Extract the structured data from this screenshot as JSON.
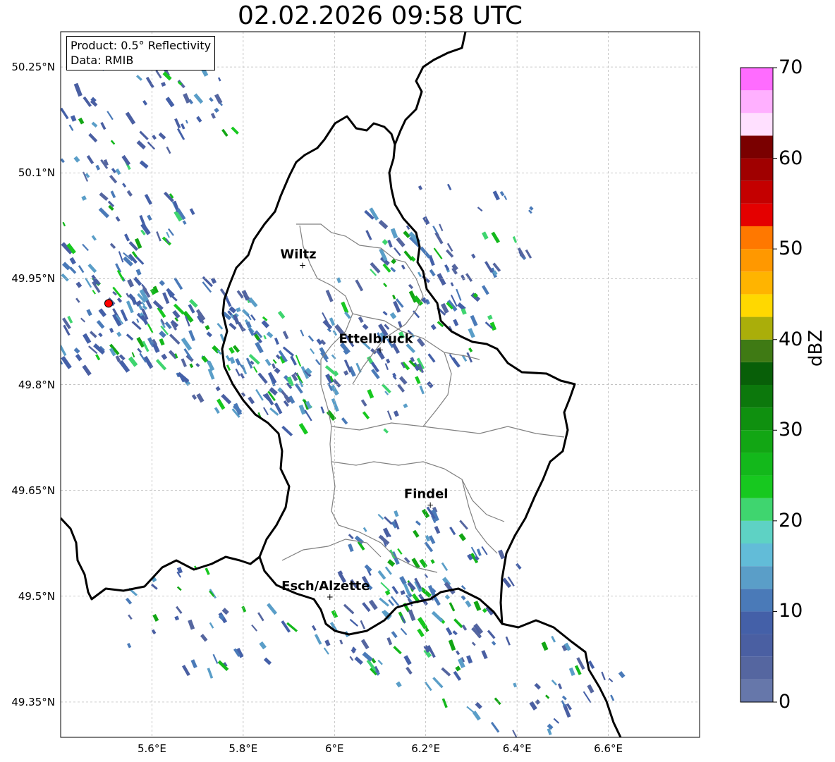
{
  "title": "02.02.2026 09:58 UTC",
  "info_box": {
    "product": "Product: 0.5° Reflectivity",
    "data": "Data: RMIB"
  },
  "map": {
    "lon_range": [
      5.4,
      6.8
    ],
    "lat_range": [
      49.3,
      50.3
    ],
    "lat_ticks": [
      {
        "value": 50.25,
        "label": "50.25°N"
      },
      {
        "value": 50.1,
        "label": "50.1°N"
      },
      {
        "value": 49.95,
        "label": "49.95°N"
      },
      {
        "value": 49.8,
        "label": "49.8°N"
      },
      {
        "value": 49.65,
        "label": "49.65°N"
      },
      {
        "value": 49.5,
        "label": "49.5°N"
      },
      {
        "value": 49.35,
        "label": "49.35°N"
      }
    ],
    "lon_ticks": [
      {
        "value": 5.6,
        "label": "5.6°E"
      },
      {
        "value": 5.8,
        "label": "5.8°E"
      },
      {
        "value": 6.0,
        "label": "6°E"
      },
      {
        "value": 6.2,
        "label": "6.2°E"
      },
      {
        "value": 6.4,
        "label": "6.4°E"
      },
      {
        "value": 6.6,
        "label": "6.6°E"
      }
    ],
    "cities": [
      {
        "name": "Wiltz",
        "lon": 5.93,
        "lat": 49.97
      },
      {
        "name": "Ettelbruck",
        "lon": 6.1,
        "lat": 49.85
      },
      {
        "name": "Findel",
        "lon": 6.21,
        "lat": 49.63
      },
      {
        "name": "Esch/Alzette",
        "lon": 5.99,
        "lat": 49.5
      }
    ],
    "radar_site": {
      "lon": 5.505,
      "lat": 49.915,
      "color": "#ff0000"
    },
    "colors": {
      "grid": "#b0b0b0",
      "national_border": "#000000",
      "canton_border": "#808080",
      "frame": "#000000"
    },
    "precip_cores": [
      {
        "lon": 5.45,
        "lat": 49.9,
        "intensity": 0.35
      },
      {
        "lon": 5.65,
        "lat": 49.88,
        "intensity": 0.4
      },
      {
        "lon": 5.85,
        "lat": 49.83,
        "intensity": 0.3
      },
      {
        "lon": 6.0,
        "lat": 49.8,
        "intensity": 0.25
      },
      {
        "lon": 6.15,
        "lat": 49.9,
        "intensity": 0.3
      },
      {
        "lon": 6.25,
        "lat": 50.02,
        "intensity": 0.2
      },
      {
        "lon": 5.6,
        "lat": 50.2,
        "intensity": 0.2
      },
      {
        "lon": 6.2,
        "lat": 49.55,
        "intensity": 0.3
      },
      {
        "lon": 6.15,
        "lat": 49.45,
        "intensity": 0.3
      },
      {
        "lon": 6.42,
        "lat": 49.38,
        "intensity": 0.15
      },
      {
        "lon": 5.72,
        "lat": 49.47,
        "intensity": 0.15
      },
      {
        "lon": 5.48,
        "lat": 50.05,
        "intensity": 0.25
      }
    ]
  },
  "colorbar": {
    "label": "dBZ",
    "min": 0,
    "max": 70,
    "step": 2.5,
    "ticks": [
      {
        "value": 0,
        "label": "0"
      },
      {
        "value": 10,
        "label": "10"
      },
      {
        "value": 20,
        "label": "20"
      },
      {
        "value": 30,
        "label": "30"
      },
      {
        "value": 40,
        "label": "40"
      },
      {
        "value": 50,
        "label": "50"
      },
      {
        "value": 60,
        "label": "60"
      },
      {
        "value": 70,
        "label": "70"
      }
    ],
    "colors": [
      "#6677aa",
      "#5566a0",
      "#4a5fa2",
      "#4460a8",
      "#4a7ab8",
      "#5a9ec8",
      "#62bcd8",
      "#5ed2c4",
      "#3fd56f",
      "#17c81f",
      "#13b81b",
      "#12a614",
      "#0f900f",
      "#0c780c",
      "#085f08",
      "#3f7a14",
      "#aaae0a",
      "#ffd800",
      "#ffb400",
      "#ff9800",
      "#ff7800",
      "#e40000",
      "#c40000",
      "#a00000",
      "#7a0000",
      "#ffe0ff",
      "#ffb0ff",
      "#ff6cff",
      "#ee3cee"
    ]
  }
}
